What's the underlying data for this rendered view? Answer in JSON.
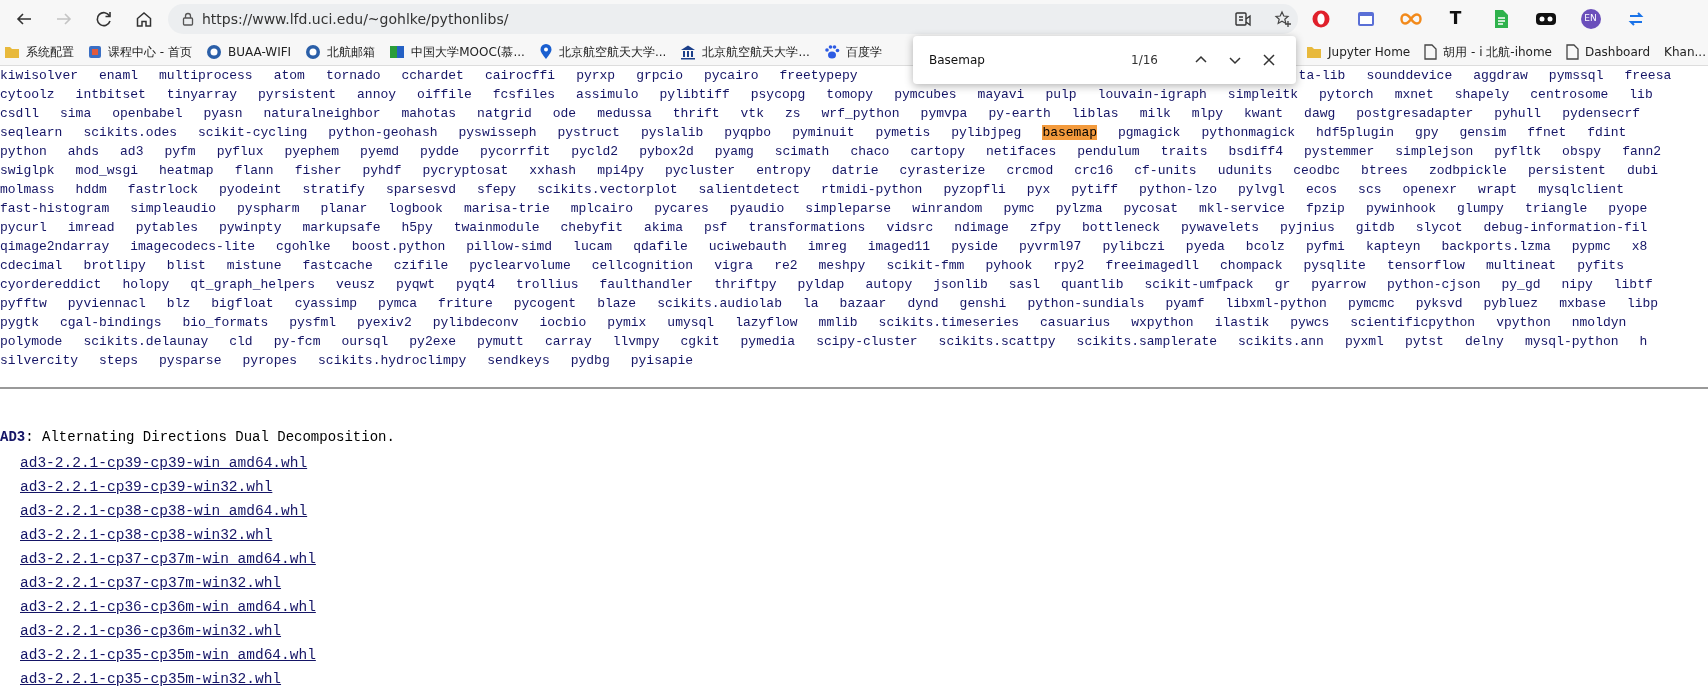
{
  "browser": {
    "nav_buttons": [
      {
        "kind": "back",
        "disabled": false
      },
      {
        "kind": "forward",
        "disabled": true
      },
      {
        "kind": "refresh",
        "disabled": false
      },
      {
        "kind": "home",
        "disabled": false
      }
    ],
    "address": "https://www.lfd.uci.edu/~gohlke/pythonlibs/",
    "extensions": [
      {
        "kind": "ring"
      },
      {
        "kind": "window"
      },
      {
        "kind": "infinity"
      },
      {
        "kind": "letter",
        "label": "T"
      },
      {
        "kind": "sheet"
      },
      {
        "kind": "mask"
      },
      {
        "kind": "badge",
        "label": "EN"
      },
      {
        "kind": "sync"
      }
    ],
    "bookmarks": [
      {
        "kind": "folder",
        "label": "系统配置"
      },
      {
        "kind": "square",
        "label": "课程中心 - 首页"
      },
      {
        "kind": "circle",
        "label": "BUAA-WIFI"
      },
      {
        "kind": "circle",
        "label": "北航邮箱"
      },
      {
        "kind": "flag",
        "label": "中国大学MOOC(慕..."
      },
      {
        "kind": "pin",
        "label": "北京航空航天大学..."
      },
      {
        "kind": "building",
        "label": "北京航空航天大学..."
      },
      {
        "kind": "paw",
        "label": "百度学"
      }
    ],
    "bookmarks_right": [
      {
        "kind": "folder",
        "label": "Jupyter Home"
      },
      {
        "kind": "page",
        "label": "胡用 - i 北航-ihome"
      },
      {
        "kind": "page",
        "label": "Dashboard"
      },
      {
        "kind": "none",
        "label": "Khan..."
      }
    ]
  },
  "find_bar": {
    "query": "Basemap",
    "count": "1/16"
  },
  "package_rows": [
    {
      "segments": [
        {
          "kind": "plain",
          "items": [
            "kiwisolver",
            "enaml",
            "multiprocess",
            "atom",
            "tornado",
            "cchardet",
            "cairocffi",
            "pyrxp",
            "grpcio",
            "pycairo",
            "freetypepy"
          ]
        },
        {
          "kind": "past-find-bar",
          "items": [
            "ta-lib",
            "sounddevice",
            "aggdraw",
            "pymssql",
            "freesa"
          ]
        }
      ]
    },
    {
      "segments": [
        {
          "kind": "plain",
          "items": [
            "cytoolz",
            "intbitset",
            "tinyarray",
            "pyrsistent",
            "annoy",
            "oiffile",
            "fcsfiles",
            "assimulo",
            "pylibtiff",
            "psycopg",
            "tomopy",
            "pymcubes",
            "mayavi",
            "pulp",
            "louvain-igraph",
            "simpleitk",
            "pytorch",
            "mxnet",
            "shapely",
            "centrosome",
            "lib"
          ]
        }
      ]
    },
    {
      "segments": [
        {
          "kind": "plain",
          "items": [
            "csdll",
            "sima",
            "openbabel",
            "pyasn",
            "naturalneighbor",
            "mahotas",
            "natgrid",
            "ode",
            "medussa",
            "thrift",
            "vtk",
            "zs",
            "wrf_python",
            "pymvpa",
            "py-earth",
            "liblas",
            "milk",
            "mlpy",
            "kwant",
            "dawg",
            "postgresadapter",
            "pyhull",
            "pydensecrf"
          ]
        }
      ]
    },
    {
      "segments": [
        {
          "kind": "plain",
          "items": [
            "seqlearn",
            "scikits.odes",
            "scikit-cycling",
            "python-geohash",
            "pyswisseph",
            "pystruct",
            "pyslalib",
            "pyqpbo",
            "pyminuit",
            "pymetis",
            "pylibjpeg"
          ]
        },
        {
          "kind": "match",
          "items": [
            "basemap"
          ]
        },
        {
          "kind": "plain",
          "items": [
            "pgmagick",
            "pythonmagick",
            "hdf5plugin",
            "gpy",
            "gensim",
            "ffnet",
            "fdint"
          ]
        }
      ]
    },
    {
      "segments": [
        {
          "kind": "plain",
          "items": [
            "python",
            "ahds",
            "ad3",
            "pyfm",
            "pyflux",
            "pyephem",
            "pyemd",
            "pydde",
            "pycorrfit",
            "pycld2",
            "pybox2d",
            "pyamg",
            "scimath",
            "chaco",
            "cartopy",
            "netifaces",
            "pendulum",
            "traits",
            "bsdiff4",
            "pystemmer",
            "simplejson",
            "pyfltk",
            "obspy",
            "fann2"
          ]
        }
      ]
    },
    {
      "segments": [
        {
          "kind": "plain",
          "items": [
            "swiglpk",
            "mod_wsgi",
            "heatmap",
            "flann",
            "fisher",
            "pyhdf",
            "pycryptosat",
            "xxhash",
            "mpi4py",
            "pycluster",
            "entropy",
            "datrie",
            "cyrasterize",
            "crcmod",
            "crc16",
            "cf-units",
            "udunits",
            "ceodbc",
            "btrees",
            "zodbpickle",
            "persistent",
            "dubi"
          ]
        }
      ]
    },
    {
      "segments": [
        {
          "kind": "plain",
          "items": [
            "molmass",
            "hddm",
            "fastrlock",
            "pyodeint",
            "stratify",
            "sparsesvd",
            "sfepy",
            "scikits.vectorplot",
            "salientdetect",
            "rtmidi-python",
            "pyzopfli",
            "pyx",
            "pytiff",
            "python-lzo",
            "pylvgl",
            "ecos",
            "scs",
            "openexr",
            "wrapt",
            "mysqlclient"
          ]
        }
      ]
    },
    {
      "segments": [
        {
          "kind": "plain",
          "items": [
            "fast-histogram",
            "simpleaudio",
            "pyspharm",
            "planar",
            "logbook",
            "marisa-trie",
            "mplcairo",
            "pycares",
            "pyaudio",
            "simpleparse",
            "winrandom",
            "pymc",
            "pylzma",
            "pycosat",
            "mkl-service",
            "fpzip",
            "pywinhook",
            "glumpy",
            "triangle",
            "pyope"
          ]
        }
      ]
    },
    {
      "segments": [
        {
          "kind": "plain",
          "items": [
            "pycurl",
            "imread",
            "pytables",
            "pywinpty",
            "markupsafe",
            "h5py",
            "twainmodule",
            "chebyfit",
            "akima",
            "psf",
            "transformations",
            "vidsrc",
            "ndimage",
            "zfpy",
            "bottleneck",
            "pywavelets",
            "pyjnius",
            "gitdb",
            "slycot",
            "debug-information-fil"
          ]
        }
      ]
    },
    {
      "segments": [
        {
          "kind": "plain",
          "items": [
            "qimage2ndarray",
            "imagecodecs-lite",
            "cgohlke",
            "boost.python",
            "pillow-simd",
            "lucam",
            "qdafile",
            "uciwebauth",
            "imreg",
            "imaged11",
            "pyside",
            "pyvrml97",
            "pylibczi",
            "pyeda",
            "bcolz",
            "pyfmi",
            "kapteyn",
            "backports.lzma",
            "pypmc",
            "x8"
          ]
        }
      ]
    },
    {
      "segments": [
        {
          "kind": "plain",
          "items": [
            "cdecimal",
            "brotlipy",
            "blist",
            "mistune",
            "fastcache",
            "czifile",
            "pyclearvolume",
            "cellcognition",
            "vigra",
            "re2",
            "meshpy",
            "scikit-fmm",
            "pyhook",
            "rpy2",
            "freeimagedll",
            "chompack",
            "pysqlite",
            "tensorflow",
            "multineat",
            "pyfits"
          ]
        }
      ]
    },
    {
      "segments": [
        {
          "kind": "plain",
          "items": [
            "cyordereddict",
            "holopy",
            "qt_graph_helpers",
            "veusz",
            "pyqwt",
            "pyqt4",
            "trollius",
            "faulthandler",
            "thriftpy",
            "pyldap",
            "autopy",
            "jsonlib",
            "sasl",
            "quantlib",
            "scikit-umfpack",
            "gr",
            "pyarrow",
            "python-cjson",
            "py_gd",
            "nipy",
            "libtf"
          ]
        }
      ]
    },
    {
      "segments": [
        {
          "kind": "plain",
          "items": [
            "pyfftw",
            "pyviennacl",
            "blz",
            "bigfloat",
            "cyassimp",
            "pymca",
            "friture",
            "pycogent",
            "blaze",
            "scikits.audiolab",
            "la",
            "bazaar",
            "dynd",
            "genshi",
            "python-sundials",
            "pyamf",
            "libxml-python",
            "pymcmc",
            "pyksvd",
            "pybluez",
            "mxbase",
            "libp"
          ]
        }
      ]
    },
    {
      "segments": [
        {
          "kind": "plain",
          "items": [
            "pygtk",
            "cgal-bindings",
            "bio_formats",
            "pysfml",
            "pyexiv2",
            "pylibdeconv",
            "iocbio",
            "pymix",
            "umysql",
            "lazyflow",
            "mmlib",
            "scikits.timeseries",
            "casuarius",
            "wxpython",
            "ilastik",
            "pywcs",
            "scientificpython",
            "vpython",
            "nmoldyn"
          ]
        }
      ]
    },
    {
      "segments": [
        {
          "kind": "plain",
          "items": [
            "polymode",
            "scikits.delaunay",
            "cld",
            "py-fcm",
            "oursql",
            "py2exe",
            "pymutt",
            "carray",
            "llvmpy",
            "cgkit",
            "pymedia",
            "scipy-cluster",
            "scikits.scattpy",
            "scikits.samplerate",
            "scikits.ann",
            "pyxml",
            "pytst",
            "delny",
            "mysql-python",
            "h"
          ]
        }
      ]
    },
    {
      "segments": [
        {
          "kind": "plain",
          "items": [
            "silvercity",
            "steps",
            "pysparse",
            "pyropes",
            "scikits.hydroclimpy",
            "sendkeys",
            "pydbg",
            "pyisapie"
          ]
        }
      ]
    }
  ],
  "package": {
    "description": "**AD3**: Alternating Directions Dual Decomposition.",
    "files": [
      "ad3-2.2.1-cp39-cp39-win_amd64.whl",
      "ad3-2.2.1-cp39-cp39-win32.whl",
      "ad3-2.2.1-cp38-cp38-win_amd64.whl",
      "ad3-2.2.1-cp38-cp38-win32.whl",
      "ad3-2.2.1-cp37-cp37m-win_amd64.whl",
      "ad3-2.2.1-cp37-cp37m-win32.whl",
      "ad3-2.2.1-cp36-cp36m-win_amd64.whl",
      "ad3-2.2.1-cp36-cp36m-win32.whl",
      "ad3-2.2.1-cp35-cp35m-win_amd64.whl",
      "ad3-2.2.1-cp35-cp35m-win32.whl"
    ]
  }
}
